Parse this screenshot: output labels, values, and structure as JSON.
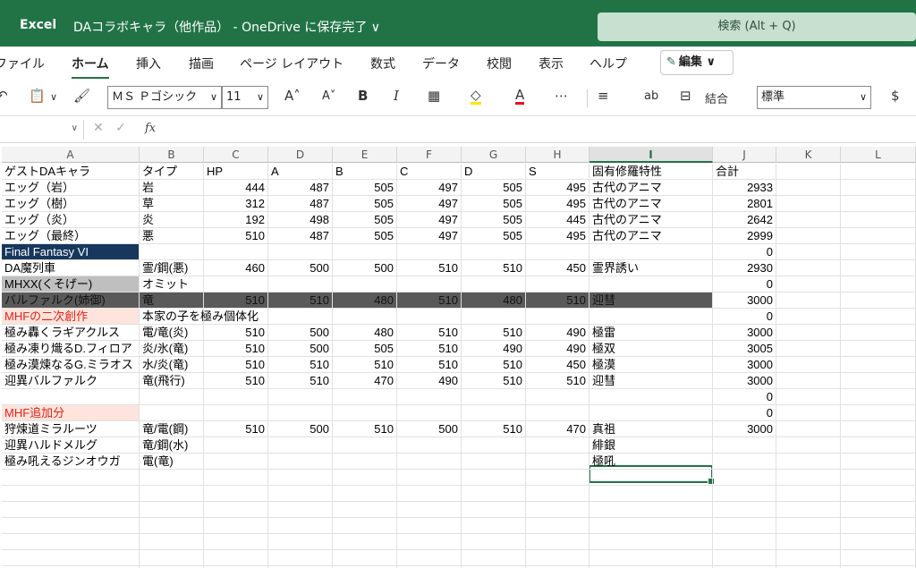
{
  "titlebar": {
    "app": "Excel",
    "document": "DAコラボキャラ（他作品） - OneDrive に保存完了 ∨",
    "search_placeholder": "検索 (Alt + Q)"
  },
  "ribbon": {
    "tabs": [
      "ファイル",
      "ホーム",
      "挿入",
      "描画",
      "ページ レイアウト",
      "数式",
      "データ",
      "校閲",
      "表示",
      "ヘルプ"
    ],
    "active_tab": "ホーム",
    "edit_label": "編集"
  },
  "toolbar": {
    "font_name": "ＭＳ Ｐゴシック",
    "font_size": "11",
    "merge_label": "結合",
    "number_format": "標準",
    "currency": "$"
  },
  "formula_bar": {
    "name_box": "",
    "fx": "fx",
    "value": ""
  },
  "sheet": {
    "columns": [
      "A",
      "B",
      "C",
      "D",
      "E",
      "F",
      "G",
      "H",
      "I",
      "J",
      "K",
      "L"
    ],
    "selected_column": "I",
    "header_row": [
      "ゲストDAキャラ",
      "タイプ",
      "HP",
      "A",
      "B",
      "C",
      "D",
      "S",
      "固有修羅特性",
      "合計",
      "",
      ""
    ],
    "rows": [
      {
        "style": "partial",
        "cells": [
          "エッグ（岩）",
          "岩",
          "444",
          "487",
          "505",
          "497",
          "505",
          "495",
          "古代のアニマ",
          "2933",
          "",
          ""
        ]
      },
      {
        "style": "",
        "cells": [
          "エッグ（樹）",
          "草",
          "312",
          "487",
          "505",
          "497",
          "505",
          "495",
          "古代のアニマ",
          "2801",
          "",
          ""
        ]
      },
      {
        "style": "",
        "cells": [
          "エッグ（炎）",
          "炎",
          "192",
          "498",
          "505",
          "497",
          "505",
          "445",
          "古代のアニマ",
          "2642",
          "",
          ""
        ]
      },
      {
        "style": "",
        "cells": [
          "エッグ（最終）",
          "悪",
          "510",
          "487",
          "505",
          "497",
          "505",
          "495",
          "古代のアニマ",
          "2999",
          "",
          ""
        ]
      },
      {
        "style": "blue",
        "cells": [
          "Final Fantasy VI",
          "",
          "",
          "",
          "",
          "",
          "",
          "",
          "",
          "0",
          "",
          ""
        ]
      },
      {
        "style": "",
        "cells": [
          "DA魔列車",
          "霊/鋼(悪)",
          "460",
          "500",
          "500",
          "510",
          "510",
          "450",
          "霊界誘い",
          "2930",
          "",
          ""
        ]
      },
      {
        "style": "gray",
        "cells": [
          "MHXX(くそげー)",
          "オミット",
          "",
          "",
          "",
          "",
          "",
          "",
          "",
          "0",
          "",
          ""
        ]
      },
      {
        "style": "dark",
        "cells": [
          "バルファルク(姉御)",
          "竜",
          "510",
          "510",
          "480",
          "510",
          "480",
          "510",
          "迎彗",
          "3000",
          "",
          ""
        ]
      },
      {
        "style": "pink",
        "cells": [
          "MHFの二次創作",
          "本家の子を極み個体化",
          "",
          "",
          "",
          "",
          "",
          "",
          "",
          "0",
          "",
          ""
        ]
      },
      {
        "style": "",
        "cells": [
          "極み轟くラギアクルス",
          "電/竜(炎)",
          "510",
          "500",
          "480",
          "510",
          "510",
          "490",
          "極雷",
          "3000",
          "",
          ""
        ]
      },
      {
        "style": "",
        "cells": [
          "極み凍り熾るD.フィロア",
          "炎/氷(竜)",
          "510",
          "500",
          "505",
          "510",
          "490",
          "490",
          "極双",
          "3005",
          "",
          ""
        ]
      },
      {
        "style": "",
        "cells": [
          "極み漠煉なるG.ミラオス",
          "水/炎(竜)",
          "510",
          "510",
          "510",
          "510",
          "510",
          "450",
          "極漠",
          "3000",
          "",
          ""
        ]
      },
      {
        "style": "",
        "cells": [
          "迎異バルファルク",
          "竜(飛行)",
          "510",
          "510",
          "470",
          "490",
          "510",
          "510",
          "迎彗",
          "3000",
          "",
          ""
        ]
      },
      {
        "style": "",
        "cells": [
          "",
          "",
          "",
          "",
          "",
          "",
          "",
          "",
          "",
          "0",
          "",
          ""
        ]
      },
      {
        "style": "pink",
        "cells": [
          "MHF追加分",
          "",
          "",
          "",
          "",
          "",
          "",
          "",
          "",
          "0",
          "",
          ""
        ]
      },
      {
        "style": "",
        "cells": [
          "狩煉道ミラルーツ",
          "竜/電(鋼)",
          "510",
          "500",
          "510",
          "500",
          "510",
          "470",
          "真祖",
          "3000",
          "",
          ""
        ]
      },
      {
        "style": "",
        "cells": [
          "迎異ハルドメルグ",
          "竜/鋼(水)",
          "",
          "",
          "",
          "",
          "",
          "",
          "緋銀",
          "",
          "",
          ""
        ]
      },
      {
        "style": "",
        "cells": [
          "極み吼えるジンオウガ",
          "電(竜)",
          "",
          "",
          "",
          "",
          "",
          "",
          "極吼",
          "",
          "",
          ""
        ]
      },
      {
        "style": "",
        "cells": [
          "",
          "",
          "",
          "",
          "",
          "",
          "",
          "",
          "",
          "",
          "",
          ""
        ]
      },
      {
        "style": "",
        "cells": [
          "",
          "",
          "",
          "",
          "",
          "",
          "",
          "",
          "",
          "",
          "",
          ""
        ]
      },
      {
        "style": "",
        "cells": [
          "",
          "",
          "",
          "",
          "",
          "",
          "",
          "",
          "",
          "",
          "",
          ""
        ]
      },
      {
        "style": "",
        "cells": [
          "",
          "",
          "",
          "",
          "",
          "",
          "",
          "",
          "",
          "",
          "",
          ""
        ]
      },
      {
        "style": "",
        "cells": [
          "",
          "",
          "",
          "",
          "",
          "",
          "",
          "",
          "",
          "",
          "",
          ""
        ]
      },
      {
        "style": "",
        "cells": [
          "",
          "",
          "",
          "",
          "",
          "",
          "",
          "",
          "",
          "",
          "",
          ""
        ]
      },
      {
        "style": "",
        "cells": [
          "",
          "",
          "",
          "",
          "",
          "",
          "",
          "",
          "",
          "",
          "",
          ""
        ]
      }
    ]
  }
}
